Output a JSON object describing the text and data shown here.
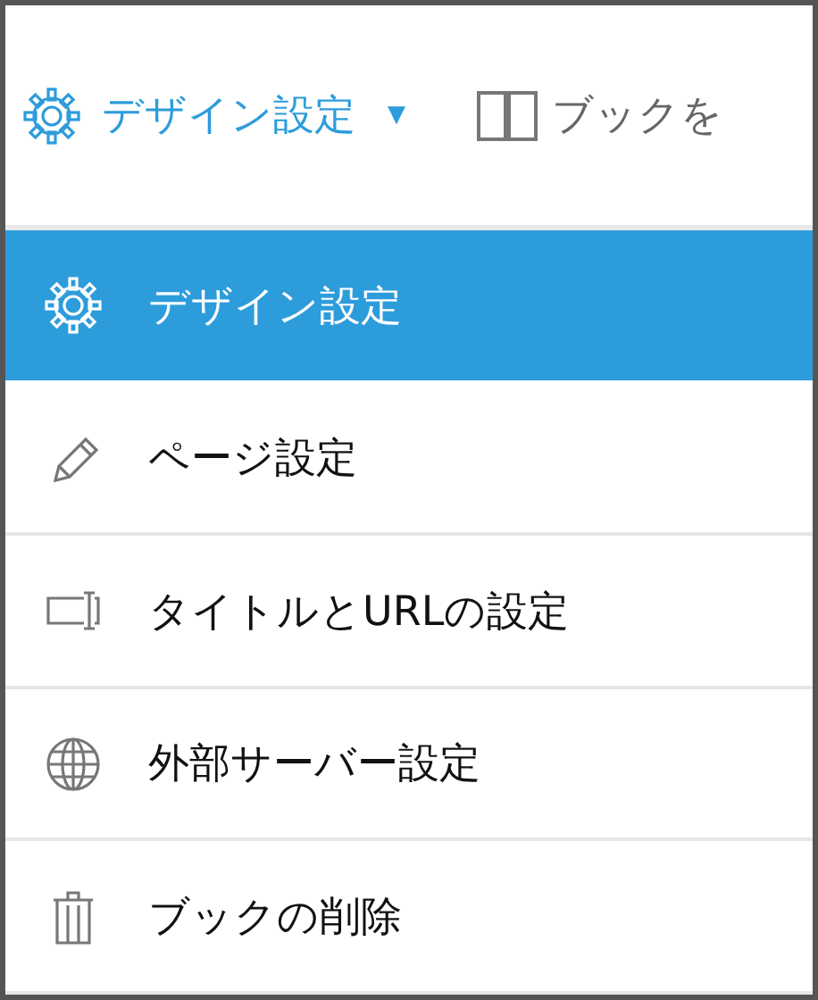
{
  "toolbar": {
    "menu_button": {
      "label": "デザイン設定",
      "caret": "▼",
      "expanded": true
    },
    "book_button": {
      "label": "ブックを"
    }
  },
  "menu": {
    "items": [
      {
        "kind": "gear",
        "label": "デザイン設定",
        "selected": true
      },
      {
        "kind": "pencil",
        "label": "ページ設定",
        "selected": false
      },
      {
        "kind": "title",
        "label": "タイトルとURLの設定",
        "selected": false
      },
      {
        "kind": "globe",
        "label": "外部サーバー設定",
        "selected": false
      },
      {
        "kind": "trash",
        "label": "ブックの削除",
        "selected": false
      }
    ]
  }
}
